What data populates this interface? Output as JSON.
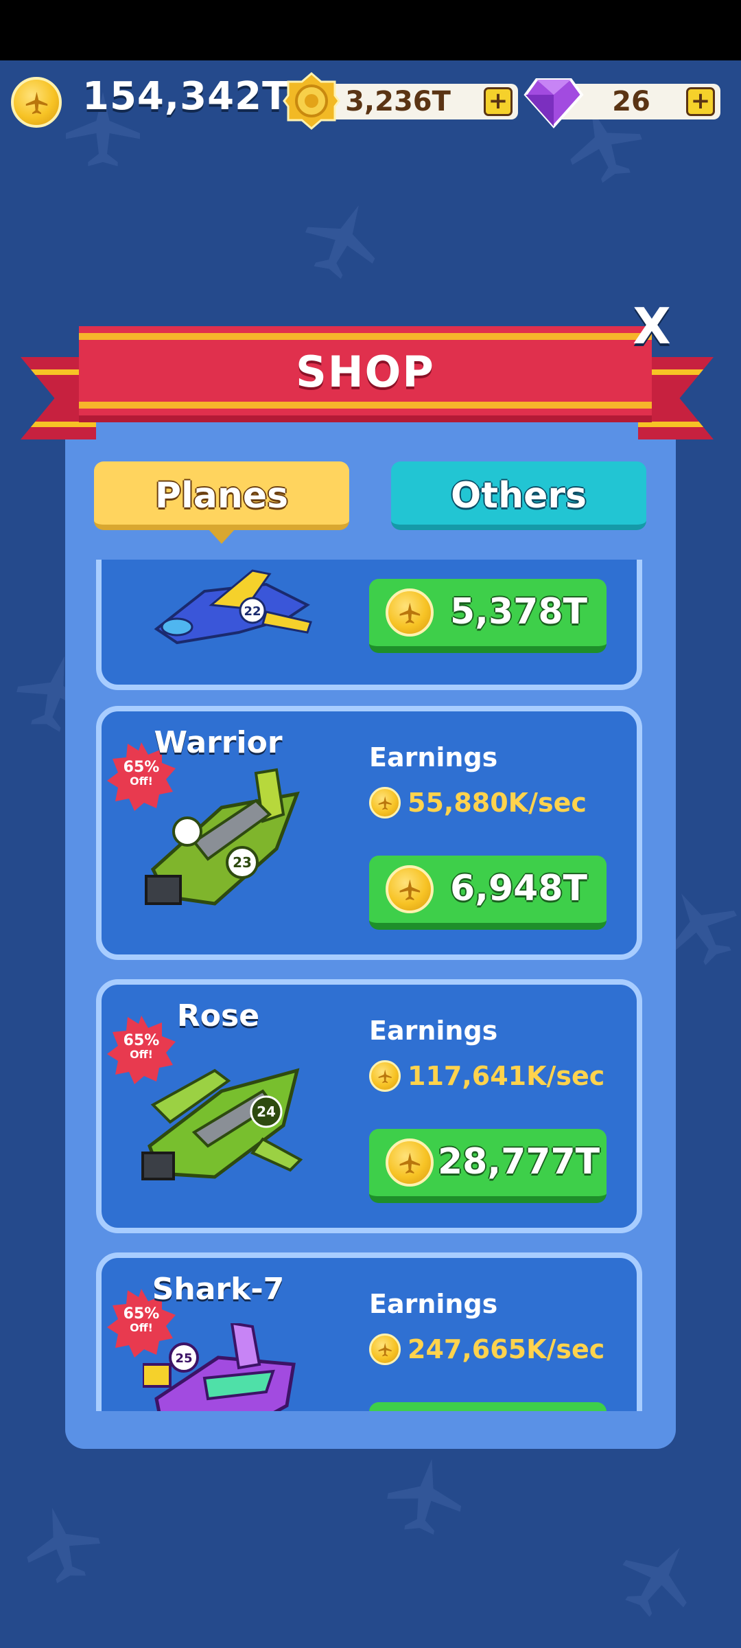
{
  "header": {
    "coin_balance": "154,342T",
    "token_balance": "3,236T",
    "gem_balance": "26",
    "plus_symbol": "+"
  },
  "shop": {
    "title": "SHOP",
    "close_label": "X",
    "tabs": {
      "planes": "Planes",
      "others": "Others"
    },
    "earnings_label": "Earnings",
    "discount": {
      "percent": "65%",
      "off": "Off!"
    },
    "items": [
      {
        "name": "",
        "rate": "",
        "price": "5,378T",
        "plane_color": "#3a56d9",
        "plane_number": "22"
      },
      {
        "name": "Warrior",
        "rate": "55,880K/sec",
        "price": "6,948T",
        "plane_color": "#7fb52c",
        "plane_number": "23"
      },
      {
        "name": "Rose",
        "rate": "117,641K/sec",
        "price": "28,777T",
        "plane_color": "#78bf2e",
        "plane_number": "24"
      },
      {
        "name": "Shark-7",
        "rate": "247,665K/sec",
        "price": "",
        "plane_color": "#a24be0",
        "plane_number": "25"
      }
    ]
  },
  "colors": {
    "background": "#254a8c",
    "ribbon": "#e0304d",
    "tab_active": "#ffd45e",
    "tab_inactive": "#22c5d3",
    "buy_button": "#3ecf4a",
    "rate_text": "#ffd34d"
  },
  "icons": {
    "coin": "gold-coin-plane-icon",
    "token": "gold-token-icon",
    "gem": "purple-gem-icon",
    "close": "close-icon",
    "plus": "plus-icon"
  }
}
